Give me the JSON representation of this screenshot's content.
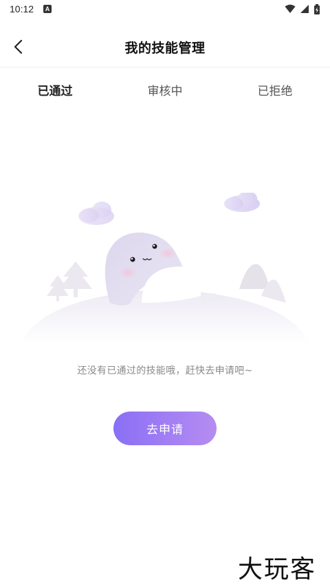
{
  "status_bar": {
    "time": "10:12",
    "app_badge": "A",
    "icons": [
      "wifi-icon",
      "signal-icon",
      "battery-icon"
    ]
  },
  "header": {
    "title": "我的技能管理",
    "back_icon": "chevron-left-icon"
  },
  "tabs": [
    {
      "label": "已通过",
      "active": true
    },
    {
      "label": "审核中",
      "active": false
    },
    {
      "label": "已拒绝",
      "active": false
    }
  ],
  "empty_state": {
    "illustration": "ghost-illustration",
    "message": "还没有已通过的技能哦，赶快去申请吧~"
  },
  "apply_button": {
    "label": "去申请",
    "gradient_start": "#8a6ff5",
    "gradient_end": "#b68cf2"
  },
  "watermark": {
    "text": "大玩客"
  }
}
